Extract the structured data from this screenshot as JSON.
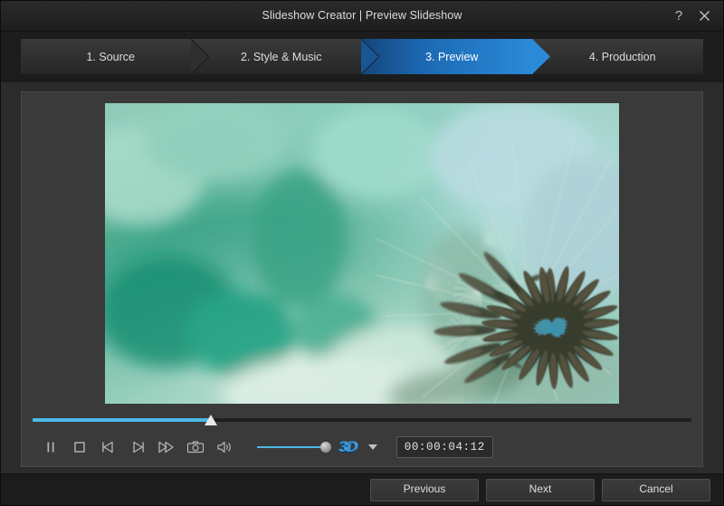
{
  "window": {
    "title": "Slideshow Creator | Preview Slideshow",
    "help_label": "?",
    "close_label": "✕"
  },
  "steps": [
    {
      "label": "1. Source",
      "active": false
    },
    {
      "label": "2. Style & Music",
      "active": false
    },
    {
      "label": "3. Preview",
      "active": true
    },
    {
      "label": "4. Production",
      "active": false
    }
  ],
  "preview": {
    "image_alt": "dandelion seed head close-up on green bokeh background",
    "progress_percent": 27,
    "volume_percent": 100
  },
  "transport": {
    "pause_label": "Pause",
    "stop_label": "Stop",
    "prev_frame_label": "Previous Frame",
    "next_frame_label": "Next Frame",
    "fast_forward_label": "Fast Forward",
    "snapshot_label": "Snapshot",
    "volume_label": "Volume",
    "badge_3d": "3D",
    "timecode": "00:00:04:12"
  },
  "footer": {
    "previous_label": "Previous",
    "next_label": "Next",
    "cancel_label": "Cancel"
  },
  "colors": {
    "accent_blue": "#2b8ad8",
    "progress_blue": "#4cb9e8",
    "window_bg": "#2b2b2b",
    "panel_bg": "#3a3a3a",
    "badge_3d": "#2f93e0"
  }
}
